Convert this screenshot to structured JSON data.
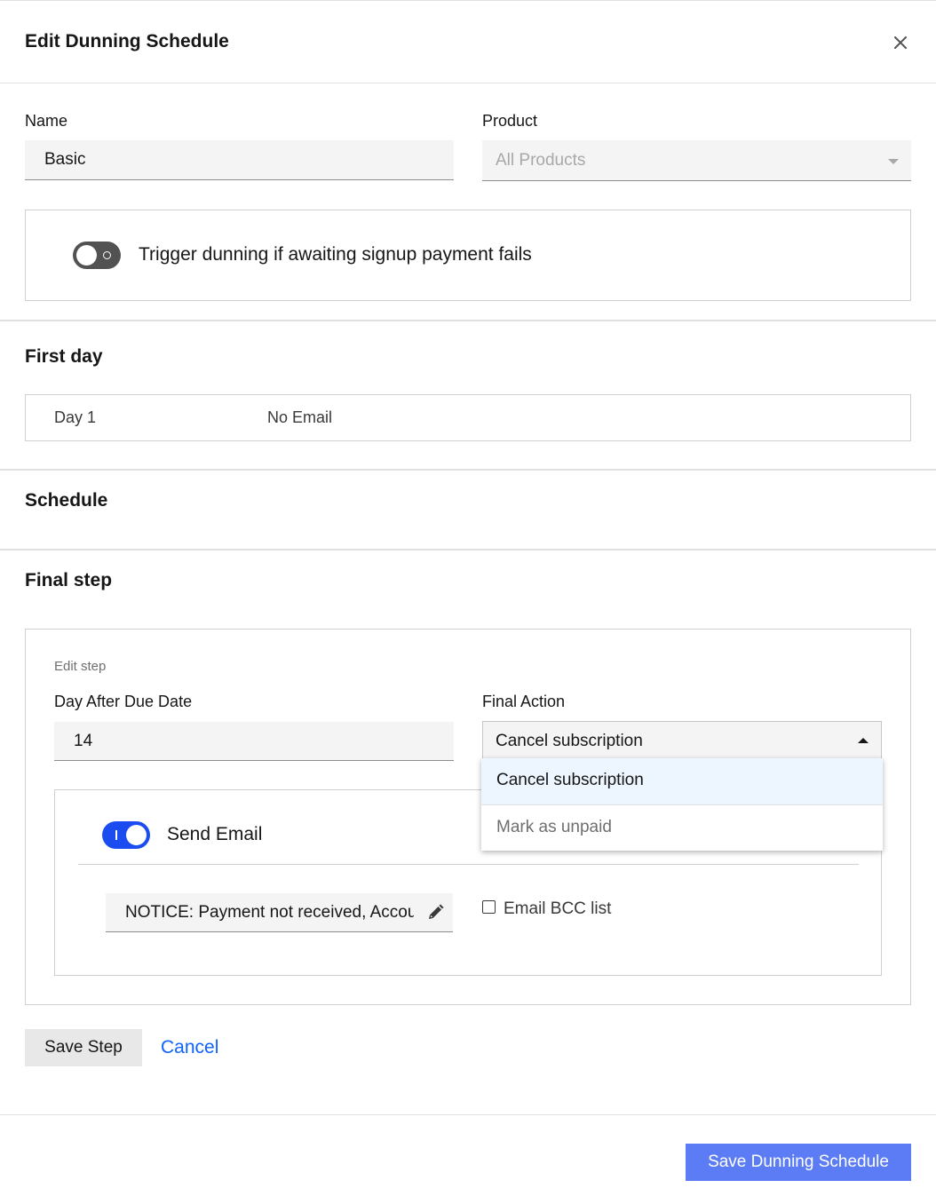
{
  "modal": {
    "title": "Edit Dunning Schedule",
    "close_icon": "close-icon"
  },
  "form": {
    "name_label": "Name",
    "name_value": "Basic",
    "product_label": "Product",
    "product_value": "All Products",
    "trigger_toggle": {
      "label": "Trigger dunning if awaiting signup payment fails",
      "state": "off"
    }
  },
  "first_day": {
    "title": "First day",
    "day": "Day 1",
    "email": "No Email"
  },
  "schedule": {
    "title": "Schedule"
  },
  "final_step": {
    "title": "Final step",
    "edit_label": "Edit step",
    "day_label": "Day After Due Date",
    "day_value": "14",
    "action_label": "Final Action",
    "action_value": "Cancel subscription",
    "action_options": [
      "Cancel subscription",
      "Mark as unpaid"
    ],
    "send_email": {
      "label": "Send Email",
      "state": "on"
    },
    "email_subject": "NOTICE: Payment not received, Account",
    "edit_icon": "pencil-icon",
    "bcc_label": "Email BCC list",
    "bcc_checked": false,
    "save_step_label": "Save Step",
    "cancel_label": "Cancel"
  },
  "footer": {
    "save_label": "Save Dunning Schedule"
  },
  "colors": {
    "primary": "#5b7cf5",
    "link": "#0f62fe",
    "toggle_on": "#1a4cf0",
    "toggle_off": "#525252"
  }
}
